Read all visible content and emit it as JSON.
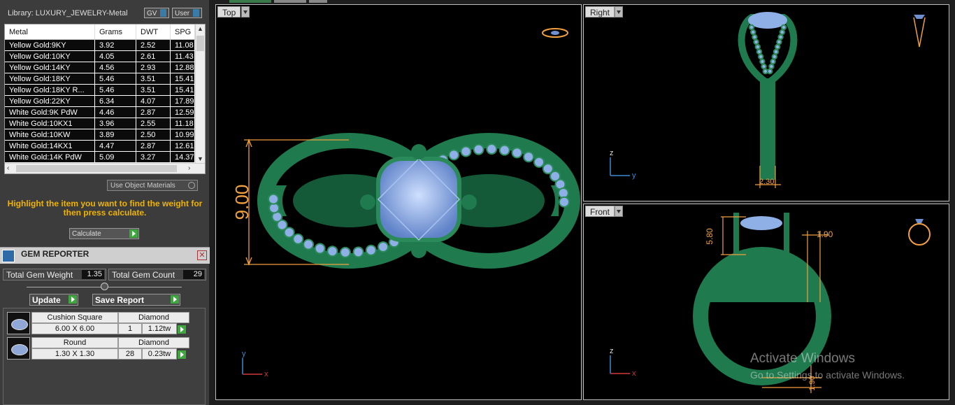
{
  "library": {
    "title": "Library: LUXURY_JEWELRY-Metal",
    "gv_label": "GV",
    "user_label": "User"
  },
  "metal_table": {
    "headers": [
      "Metal",
      "Grams",
      "DWT",
      "SPG"
    ],
    "rows": [
      [
        "Yellow Gold:9KY",
        "3.92",
        "2.52",
        "11.08"
      ],
      [
        "Yellow Gold:10KY",
        "4.05",
        "2.61",
        "11.43"
      ],
      [
        "Yellow Gold:14KY",
        "4.56",
        "2.93",
        "12.88"
      ],
      [
        "Yellow Gold:18KY",
        "5.46",
        "3.51",
        "15.41"
      ],
      [
        "Yellow Gold:18KY R...",
        "5.46",
        "3.51",
        "15.41"
      ],
      [
        "Yellow Gold:22KY",
        "6.34",
        "4.07",
        "17.89"
      ],
      [
        "White Gold:9K PdW",
        "4.46",
        "2.87",
        "12.59"
      ],
      [
        "White Gold:10KX1",
        "3.96",
        "2.55",
        "11.18"
      ],
      [
        "White Gold:10KW",
        "3.89",
        "2.50",
        "10.99"
      ],
      [
        "White Gold:14KX1",
        "4.47",
        "2.87",
        "12.61"
      ],
      [
        "White Gold:14K PdW",
        "5.09",
        "3.27",
        "14.37"
      ]
    ]
  },
  "use_object_materials": "Use Object Materials",
  "hint": "Highlight the item you want to find the weight for then press calculate.",
  "calculate_label": "Calculate",
  "gem_reporter": {
    "title": "GEM REPORTER",
    "total_weight_label": "Total Gem Weight",
    "total_weight_value": "1.35",
    "total_count_label": "Total Gem Count",
    "total_count_value": "29",
    "update_label": "Update",
    "save_label": "Save Report",
    "gems": [
      {
        "shape": "Cushion Square",
        "type": "Diamond",
        "size": "6.00 X 6.00",
        "count": "1",
        "weight": "1.12tw"
      },
      {
        "shape": "Round",
        "type": "Diamond",
        "size": "1.30 X 1.30",
        "count": "28",
        "weight": "0.23tw"
      }
    ]
  },
  "viewports": {
    "top": {
      "label": "Top",
      "dim": "9.00",
      "axis_y": "y",
      "axis_x": "x"
    },
    "right": {
      "label": "Right",
      "dim": "2.30",
      "axis_z": "z",
      "axis_y": "y"
    },
    "front": {
      "label": "Front",
      "dim_a": "5.80",
      "dim_b": "1.90",
      "dim_c": "1.90",
      "axis_z": "z",
      "axis_x": "x"
    }
  },
  "watermark": {
    "line1": "Activate Windows",
    "line2": "Go to Settings to activate Windows."
  },
  "colors": {
    "metal": "#1f7a4e",
    "metal_light": "#3aa06c",
    "gem": "#8fb0e6",
    "dim": "#f0a040",
    "accent": "#f0b400"
  }
}
